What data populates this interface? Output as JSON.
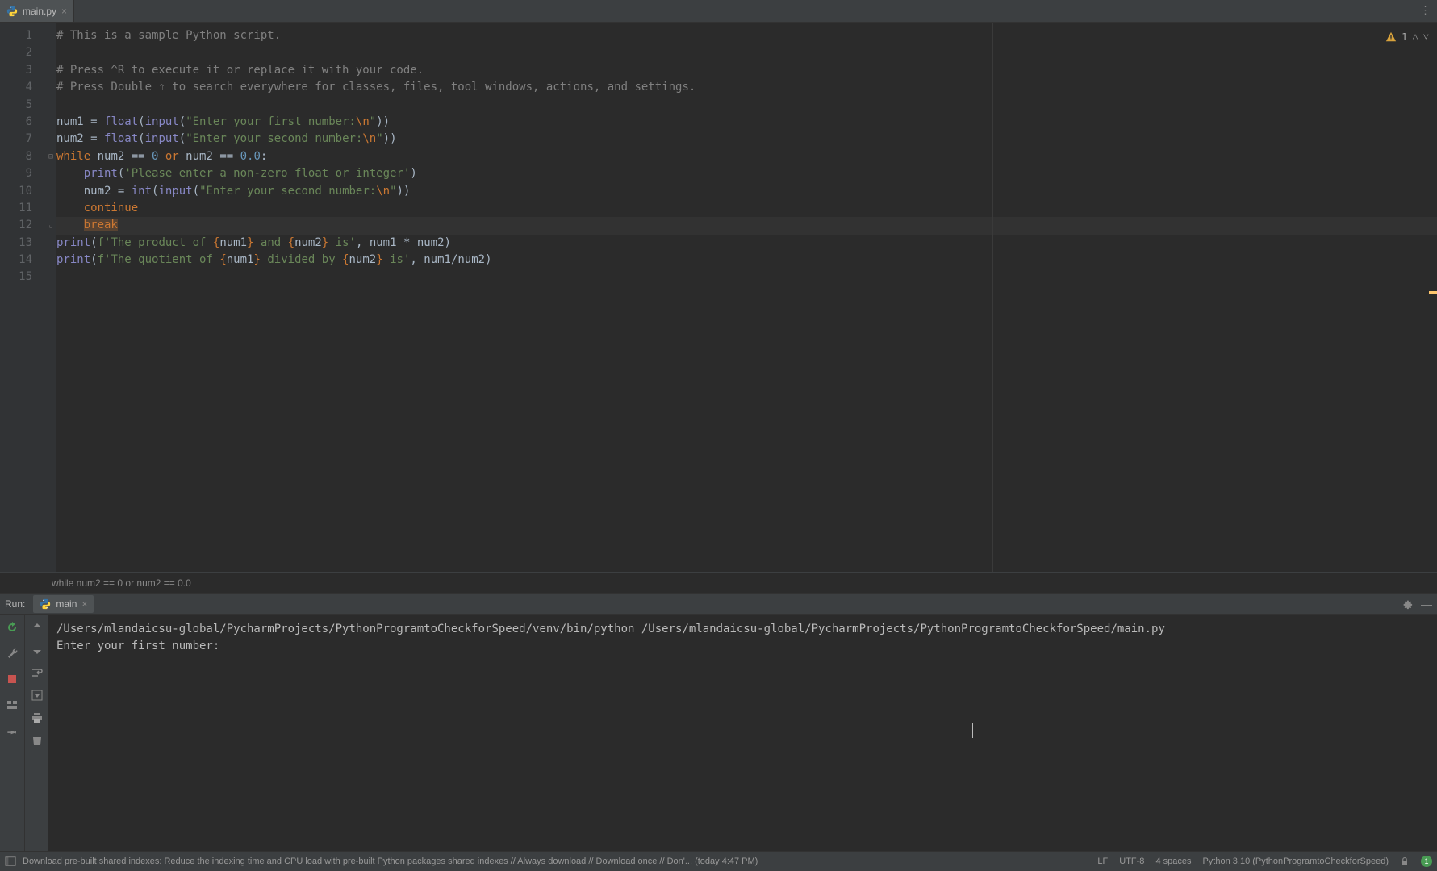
{
  "tabs": {
    "items": [
      {
        "name": "main.py"
      }
    ]
  },
  "inspections": {
    "warning_count": "1"
  },
  "editor": {
    "lines": {
      "l1_comment": "# This is a sample Python script.",
      "l3_comment": "# Press ^R to execute it or replace it with your code.",
      "l4_comment": "# Press Double ⇧ to search everywhere for classes, files, tool windows, actions, and settings.",
      "l6_var": "num1 ",
      "l6_eq": "= ",
      "l6_float": "float",
      "l6_p1": "(",
      "l6_input": "input",
      "l6_p2": "(",
      "l6_str": "\"Enter your first number:",
      "l6_esc": "\\n",
      "l6_strend": "\"",
      "l6_close": "))",
      "l7_var": "num2 ",
      "l7_float": "float",
      "l7_input": "input",
      "l7_str": "\"Enter your second number:",
      "l7_esc": "\\n",
      "l7_close": "))",
      "l8_while": "while",
      "l8_cond": " num2 == ",
      "l8_zero1": "0",
      "l8_or": " or ",
      "l8_cond2": "num2 == ",
      "l8_zero2": "0.0",
      "l8_colon": ":",
      "l9_print": "print",
      "l9_p1": "(",
      "l9_str": "'Please enter a non-zero float or integer'",
      "l9_p2": ")",
      "l10_var": "num2 ",
      "l10_int": "int",
      "l10_input": "input",
      "l10_str": "\"Enter your second number:",
      "l10_esc": "\\n",
      "l10_close": "))",
      "l11_continue": "continue",
      "l12_break": "break",
      "l13_print": "print",
      "l13_fpre": "f'",
      "l13_s1": "The product of ",
      "l13_b1o": "{",
      "l13_v1": "num1",
      "l13_b1c": "}",
      "l13_s2": " and ",
      "l13_b2o": "{",
      "l13_v2": "num2",
      "l13_b2c": "}",
      "l13_s3": " is'",
      "l13_comma": ", ",
      "l13_expr": "num1 * num2)",
      "l14_print": "print",
      "l14_fpre": "f'",
      "l14_s1": "The quotient of ",
      "l14_b1o": "{",
      "l14_v1": "num1",
      "l14_b1c": "}",
      "l14_s2": " divided by ",
      "l14_b2o": "{",
      "l14_v2": "num2",
      "l14_b2c": "}",
      "l14_s3": " is'",
      "l14_comma": ", ",
      "l14_expr": "num1/num2)"
    },
    "line_numbers": [
      "1",
      "2",
      "3",
      "4",
      "5",
      "6",
      "7",
      "8",
      "9",
      "10",
      "11",
      "12",
      "13",
      "14",
      "15"
    ],
    "breadcrumb": "while num2 == 0 or num2 == 0.0"
  },
  "run": {
    "title": "Run:",
    "tab_name": "main",
    "console": {
      "line1": "/Users/mlandaicsu-global/PycharmProjects/PythonProgramtoCheckforSpeed/venv/bin/python /Users/mlandaicsu-global/PycharmProjects/PythonProgramtoCheckforSpeed/main.py",
      "line2": "Enter your first number:"
    }
  },
  "status": {
    "message": "Download pre-built shared indexes: Reduce the indexing time and CPU load with pre-built Python packages shared indexes // Always download // Download once // Don'... (today 4:47 PM)",
    "line_sep": "LF",
    "encoding": "UTF-8",
    "indent": "4 spaces",
    "interpreter": "Python 3.10 (PythonProgramtoCheckforSpeed)",
    "indicator": "1"
  }
}
